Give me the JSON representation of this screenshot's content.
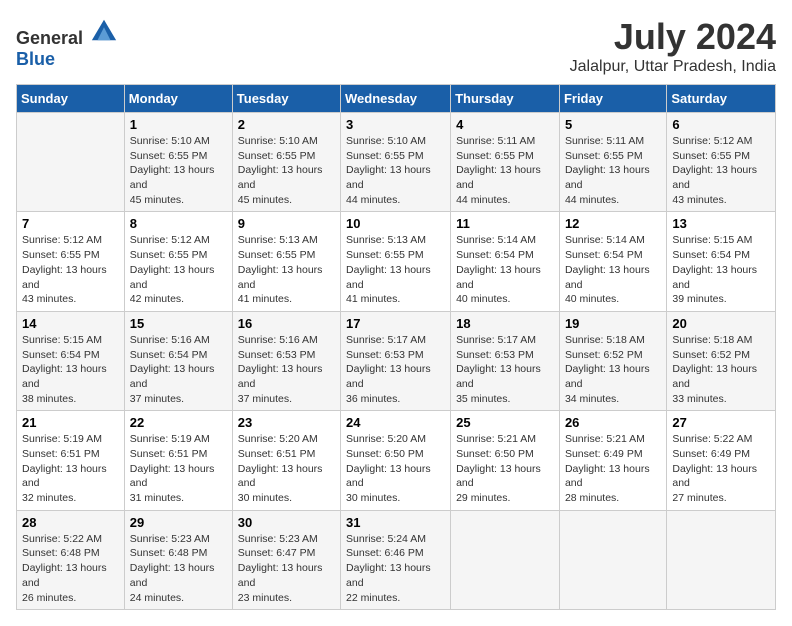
{
  "logo": {
    "general": "General",
    "blue": "Blue"
  },
  "title": "July 2024",
  "location": "Jalalpur, Uttar Pradesh, India",
  "days_of_week": [
    "Sunday",
    "Monday",
    "Tuesday",
    "Wednesday",
    "Thursday",
    "Friday",
    "Saturday"
  ],
  "weeks": [
    [
      {
        "day": "",
        "sunrise": "",
        "sunset": "",
        "daylight": ""
      },
      {
        "day": "1",
        "sunrise": "Sunrise: 5:10 AM",
        "sunset": "Sunset: 6:55 PM",
        "daylight": "Daylight: 13 hours and 45 minutes."
      },
      {
        "day": "2",
        "sunrise": "Sunrise: 5:10 AM",
        "sunset": "Sunset: 6:55 PM",
        "daylight": "Daylight: 13 hours and 45 minutes."
      },
      {
        "day": "3",
        "sunrise": "Sunrise: 5:10 AM",
        "sunset": "Sunset: 6:55 PM",
        "daylight": "Daylight: 13 hours and 44 minutes."
      },
      {
        "day": "4",
        "sunrise": "Sunrise: 5:11 AM",
        "sunset": "Sunset: 6:55 PM",
        "daylight": "Daylight: 13 hours and 44 minutes."
      },
      {
        "day": "5",
        "sunrise": "Sunrise: 5:11 AM",
        "sunset": "Sunset: 6:55 PM",
        "daylight": "Daylight: 13 hours and 44 minutes."
      },
      {
        "day": "6",
        "sunrise": "Sunrise: 5:12 AM",
        "sunset": "Sunset: 6:55 PM",
        "daylight": "Daylight: 13 hours and 43 minutes."
      }
    ],
    [
      {
        "day": "7",
        "sunrise": "Sunrise: 5:12 AM",
        "sunset": "Sunset: 6:55 PM",
        "daylight": "Daylight: 13 hours and 43 minutes."
      },
      {
        "day": "8",
        "sunrise": "Sunrise: 5:12 AM",
        "sunset": "Sunset: 6:55 PM",
        "daylight": "Daylight: 13 hours and 42 minutes."
      },
      {
        "day": "9",
        "sunrise": "Sunrise: 5:13 AM",
        "sunset": "Sunset: 6:55 PM",
        "daylight": "Daylight: 13 hours and 41 minutes."
      },
      {
        "day": "10",
        "sunrise": "Sunrise: 5:13 AM",
        "sunset": "Sunset: 6:55 PM",
        "daylight": "Daylight: 13 hours and 41 minutes."
      },
      {
        "day": "11",
        "sunrise": "Sunrise: 5:14 AM",
        "sunset": "Sunset: 6:54 PM",
        "daylight": "Daylight: 13 hours and 40 minutes."
      },
      {
        "day": "12",
        "sunrise": "Sunrise: 5:14 AM",
        "sunset": "Sunset: 6:54 PM",
        "daylight": "Daylight: 13 hours and 40 minutes."
      },
      {
        "day": "13",
        "sunrise": "Sunrise: 5:15 AM",
        "sunset": "Sunset: 6:54 PM",
        "daylight": "Daylight: 13 hours and 39 minutes."
      }
    ],
    [
      {
        "day": "14",
        "sunrise": "Sunrise: 5:15 AM",
        "sunset": "Sunset: 6:54 PM",
        "daylight": "Daylight: 13 hours and 38 minutes."
      },
      {
        "day": "15",
        "sunrise": "Sunrise: 5:16 AM",
        "sunset": "Sunset: 6:54 PM",
        "daylight": "Daylight: 13 hours and 37 minutes."
      },
      {
        "day": "16",
        "sunrise": "Sunrise: 5:16 AM",
        "sunset": "Sunset: 6:53 PM",
        "daylight": "Daylight: 13 hours and 37 minutes."
      },
      {
        "day": "17",
        "sunrise": "Sunrise: 5:17 AM",
        "sunset": "Sunset: 6:53 PM",
        "daylight": "Daylight: 13 hours and 36 minutes."
      },
      {
        "day": "18",
        "sunrise": "Sunrise: 5:17 AM",
        "sunset": "Sunset: 6:53 PM",
        "daylight": "Daylight: 13 hours and 35 minutes."
      },
      {
        "day": "19",
        "sunrise": "Sunrise: 5:18 AM",
        "sunset": "Sunset: 6:52 PM",
        "daylight": "Daylight: 13 hours and 34 minutes."
      },
      {
        "day": "20",
        "sunrise": "Sunrise: 5:18 AM",
        "sunset": "Sunset: 6:52 PM",
        "daylight": "Daylight: 13 hours and 33 minutes."
      }
    ],
    [
      {
        "day": "21",
        "sunrise": "Sunrise: 5:19 AM",
        "sunset": "Sunset: 6:51 PM",
        "daylight": "Daylight: 13 hours and 32 minutes."
      },
      {
        "day": "22",
        "sunrise": "Sunrise: 5:19 AM",
        "sunset": "Sunset: 6:51 PM",
        "daylight": "Daylight: 13 hours and 31 minutes."
      },
      {
        "day": "23",
        "sunrise": "Sunrise: 5:20 AM",
        "sunset": "Sunset: 6:51 PM",
        "daylight": "Daylight: 13 hours and 30 minutes."
      },
      {
        "day": "24",
        "sunrise": "Sunrise: 5:20 AM",
        "sunset": "Sunset: 6:50 PM",
        "daylight": "Daylight: 13 hours and 30 minutes."
      },
      {
        "day": "25",
        "sunrise": "Sunrise: 5:21 AM",
        "sunset": "Sunset: 6:50 PM",
        "daylight": "Daylight: 13 hours and 29 minutes."
      },
      {
        "day": "26",
        "sunrise": "Sunrise: 5:21 AM",
        "sunset": "Sunset: 6:49 PM",
        "daylight": "Daylight: 13 hours and 28 minutes."
      },
      {
        "day": "27",
        "sunrise": "Sunrise: 5:22 AM",
        "sunset": "Sunset: 6:49 PM",
        "daylight": "Daylight: 13 hours and 27 minutes."
      }
    ],
    [
      {
        "day": "28",
        "sunrise": "Sunrise: 5:22 AM",
        "sunset": "Sunset: 6:48 PM",
        "daylight": "Daylight: 13 hours and 26 minutes."
      },
      {
        "day": "29",
        "sunrise": "Sunrise: 5:23 AM",
        "sunset": "Sunset: 6:48 PM",
        "daylight": "Daylight: 13 hours and 24 minutes."
      },
      {
        "day": "30",
        "sunrise": "Sunrise: 5:23 AM",
        "sunset": "Sunset: 6:47 PM",
        "daylight": "Daylight: 13 hours and 23 minutes."
      },
      {
        "day": "31",
        "sunrise": "Sunrise: 5:24 AM",
        "sunset": "Sunset: 6:46 PM",
        "daylight": "Daylight: 13 hours and 22 minutes."
      },
      {
        "day": "",
        "sunrise": "",
        "sunset": "",
        "daylight": ""
      },
      {
        "day": "",
        "sunrise": "",
        "sunset": "",
        "daylight": ""
      },
      {
        "day": "",
        "sunrise": "",
        "sunset": "",
        "daylight": ""
      }
    ]
  ]
}
